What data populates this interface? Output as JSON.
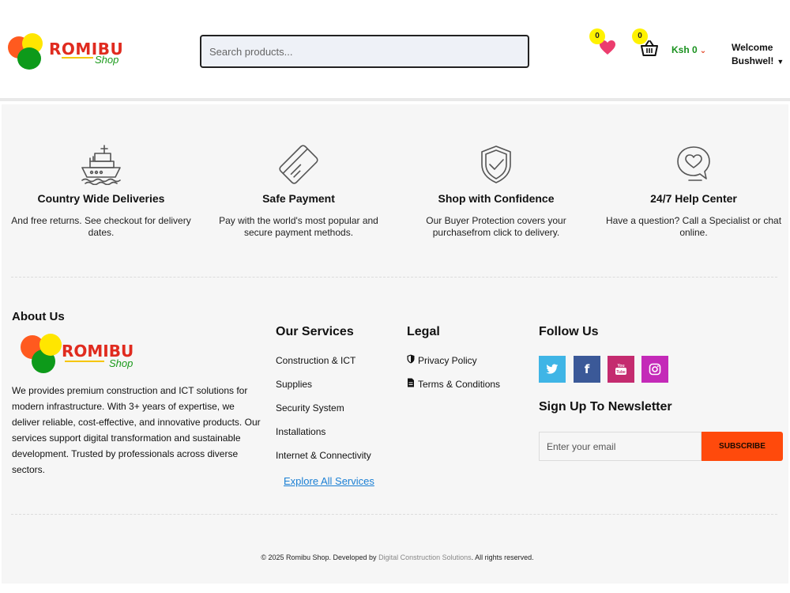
{
  "header": {
    "logo": {
      "main": "ROMIBU",
      "sub": "Shop"
    },
    "search_placeholder": "Search products...",
    "wishlist_count": "0",
    "cart_count": "0",
    "currency_total": "Ksh 0",
    "welcome_line1": "Welcome",
    "welcome_line2": "Bushwel!"
  },
  "features": [
    {
      "title": "Country Wide Deliveries",
      "desc": "And free returns. See checkout for delivery dates.",
      "icon": "ship-icon"
    },
    {
      "title": "Safe Payment",
      "desc": "Pay with the world's most popular and secure payment methods.",
      "icon": "credit-card-icon"
    },
    {
      "title": "Shop with Confidence",
      "desc": "Our Buyer Protection covers your purchasefrom click to delivery.",
      "icon": "shield-check-icon"
    },
    {
      "title": "24/7 Help Center",
      "desc": "Have a question? Call a Specialist or chat online.",
      "icon": "chat-heart-icon"
    }
  ],
  "about": {
    "heading": "About Us",
    "logo": {
      "main": "ROMIBU",
      "sub": "Shop"
    },
    "text": "We provides premium construction and ICT solutions for modern infrastructure. With 3+ years of expertise, we deliver reliable, cost-effective, and innovative products. Our services support digital transformation and sustainable development. Trusted by professionals across diverse sectors."
  },
  "services": {
    "heading": "Our Services",
    "items": [
      "Construction & ICT",
      "Supplies",
      "Security System",
      "Installations",
      "Internet & Connectivity"
    ],
    "explore": "Explore All Services"
  },
  "legal": {
    "heading": "Legal",
    "items": [
      "Privacy Policy",
      "Terms & Conditions"
    ]
  },
  "follow": {
    "heading": "Follow Us",
    "networks": [
      {
        "name": "twitter",
        "glyph": "🐦",
        "color": "#3fb5e6"
      },
      {
        "name": "facebook",
        "glyph": "f",
        "color": "#3b5998"
      },
      {
        "name": "youtube",
        "glyph": "You",
        "color": "#c4302b"
      },
      {
        "name": "instagram",
        "glyph": "◎",
        "color": "#c42aa8"
      }
    ]
  },
  "newsletter": {
    "heading": "Sign Up To Newsletter",
    "placeholder": "Enter your email",
    "button": "SUBSCRIBE"
  },
  "footer": {
    "copyright_prefix": "© 2025 Romibu Shop. Developed by ",
    "developer": "Digital Construction Solutions",
    "copyright_suffix": ". All rights reserved."
  },
  "colors": {
    "accent": "#ff4a0c",
    "link": "#1a7fd4",
    "badge": "#fff200",
    "price": "#19911e"
  }
}
